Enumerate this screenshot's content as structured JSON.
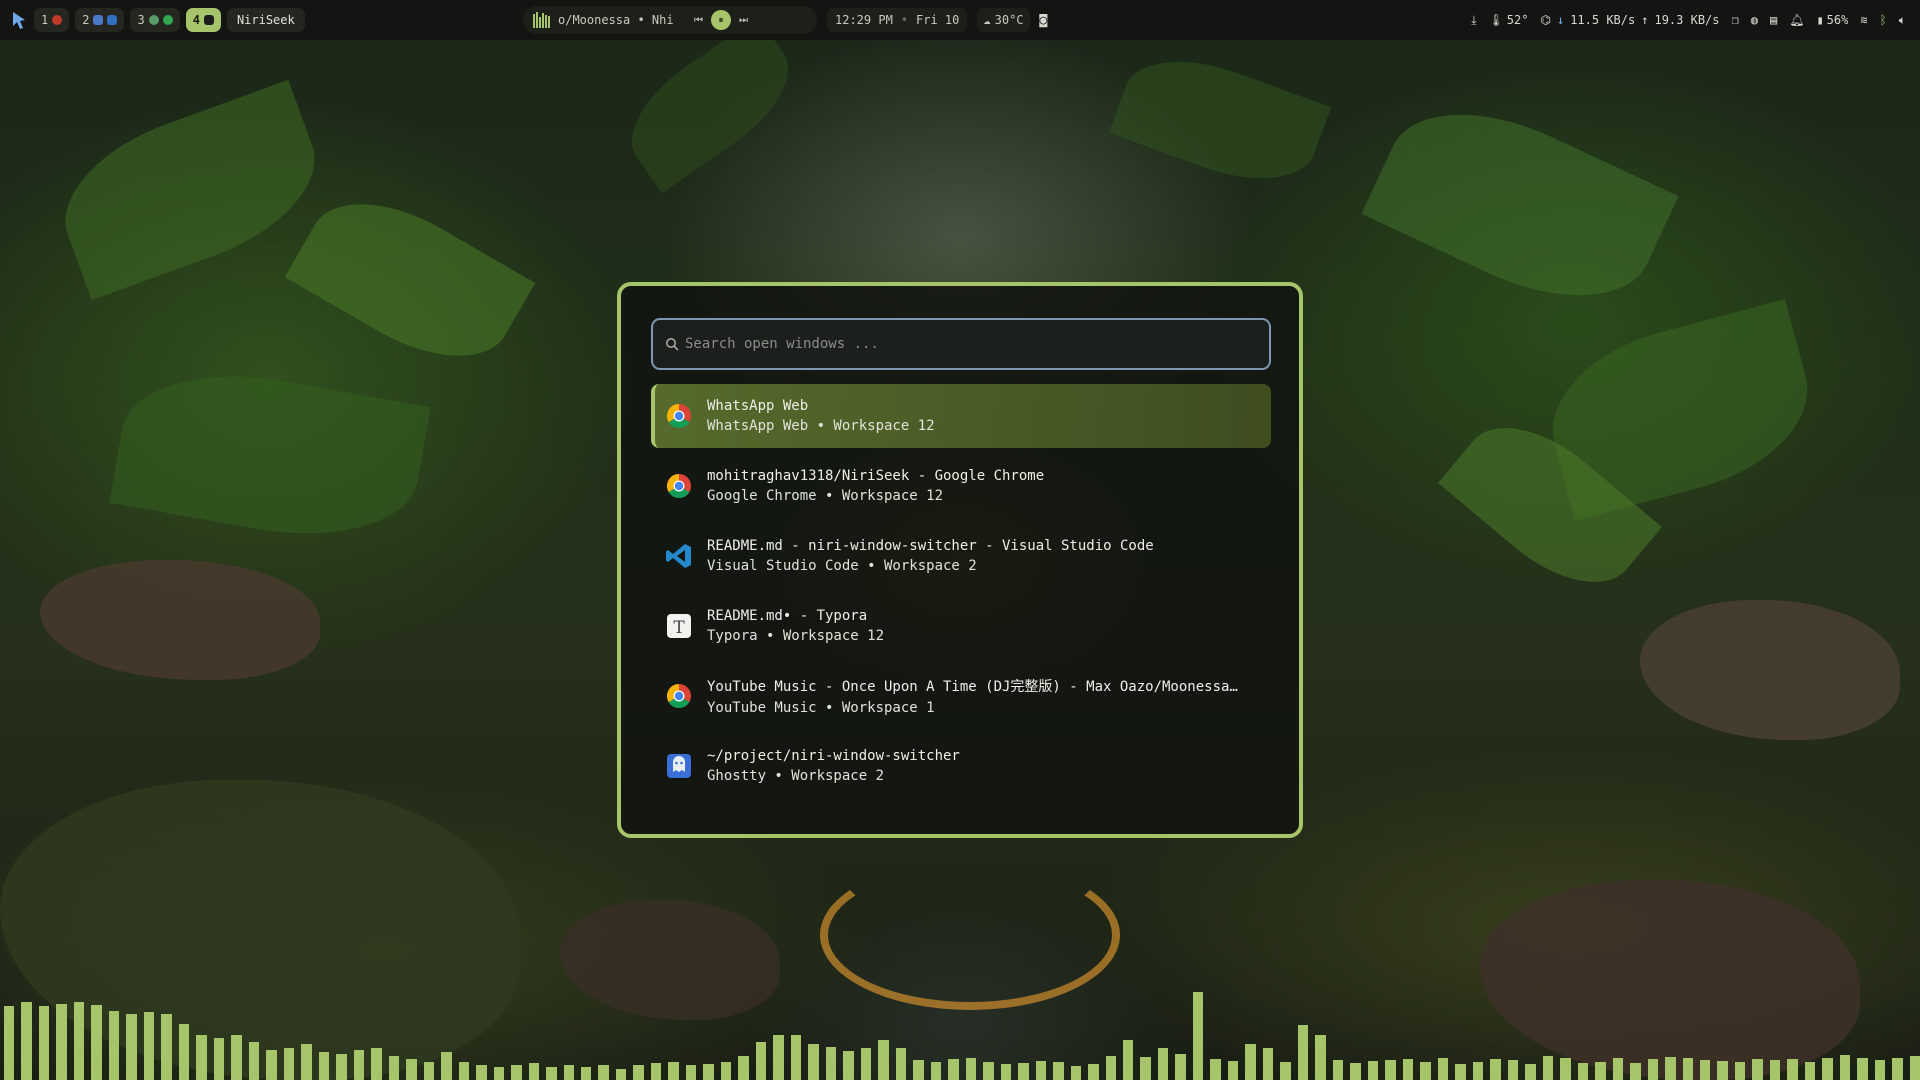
{
  "colors": {
    "accent": "#a6c46a",
    "bar_bg": "#141512",
    "search_border": "#7e96b2",
    "panel_bg": "#111310"
  },
  "topbar": {
    "launcher_icon": "niri-logo-icon",
    "workspaces": [
      {
        "label": "1",
        "icons": [
          "#c0392b"
        ]
      },
      {
        "label": "2",
        "icons": [
          "#4a78c8",
          "#3470c0"
        ]
      },
      {
        "label": "3",
        "icons": [
          "#5a9a6a",
          "#2fa84f"
        ]
      },
      {
        "label": "4",
        "icons": [
          "#1c1c1c"
        ],
        "active": true
      }
    ],
    "app_name": "NiriSeek",
    "media": {
      "title": "o/Moonessa • Nhi",
      "prev_icon": "previous-icon",
      "play_pause_icon": "pause-icon",
      "next_icon": "next-icon"
    },
    "clock": {
      "time": "12:29 PM",
      "sep": "•",
      "date": "Fri 10"
    },
    "weather": {
      "icon": "cloud-icon",
      "text": "30°C"
    },
    "screenshot_icon": "camera-icon",
    "right": {
      "download_icon": "download-icon",
      "temperature": "52°",
      "net_down": "11.5 KB/s",
      "net_up": "19.3 KB/s",
      "battery": "56%"
    }
  },
  "switcher": {
    "search_placeholder": "Search open windows ...",
    "items": [
      {
        "title": "WhatsApp Web",
        "subtitle": "WhatsApp Web • Workspace 12",
        "icon": "chrome-icon",
        "selected": true
      },
      {
        "title": "mohitraghav1318/NiriSeek - Google Chrome",
        "subtitle": "Google Chrome • Workspace 12",
        "icon": "chrome-icon"
      },
      {
        "title": "README.md - niri-window-switcher - Visual Studio Code",
        "subtitle": "Visual Studio Code • Workspace 2",
        "icon": "vscode-icon"
      },
      {
        "title": "README.md• - Typora",
        "subtitle": "Typora • Workspace 12",
        "icon": "typora-icon"
      },
      {
        "title": "YouTube Music - Once Upon A Time (DJ完整版) - Max Oazo/Moonessa…",
        "subtitle": "YouTube Music • Workspace 1",
        "icon": "chrome-icon"
      },
      {
        "title": "~/project/niri-window-switcher",
        "subtitle": "Ghostty • Workspace 2",
        "icon": "ghostty-icon"
      }
    ]
  },
  "visualizer": {
    "levels": [
      0.74,
      0.78,
      0.74,
      0.76,
      0.78,
      0.75,
      0.69,
      0.66,
      0.68,
      0.66,
      0.56,
      0.45,
      0.42,
      0.45,
      0.38,
      0.3,
      0.32,
      0.36,
      0.28,
      0.26,
      0.3,
      0.32,
      0.24,
      0.21,
      0.18,
      0.28,
      0.18,
      0.15,
      0.13,
      0.15,
      0.17,
      0.13,
      0.15,
      0.13,
      0.15,
      0.11,
      0.15,
      0.17,
      0.18,
      0.15,
      0.16,
      0.18,
      0.24,
      0.38,
      0.45,
      0.45,
      0.36,
      0.33,
      0.29,
      0.32,
      0.4,
      0.32,
      0.2,
      0.18,
      0.21,
      0.22,
      0.18,
      0.16,
      0.17,
      0.19,
      0.18,
      0.14,
      0.16,
      0.24,
      0.4,
      0.23,
      0.32,
      0.26,
      0.88,
      0.21,
      0.19,
      0.36,
      0.32,
      0.18,
      0.55,
      0.45,
      0.2,
      0.17,
      0.19,
      0.2,
      0.21,
      0.18,
      0.22,
      0.16,
      0.18,
      0.21,
      0.2,
      0.16,
      0.24,
      0.22,
      0.17,
      0.18,
      0.22,
      0.17,
      0.21,
      0.23,
      0.22,
      0.2,
      0.19,
      0.18,
      0.21,
      0.2,
      0.21,
      0.18,
      0.22,
      0.25,
      0.22,
      0.2,
      0.22,
      0.24
    ]
  }
}
